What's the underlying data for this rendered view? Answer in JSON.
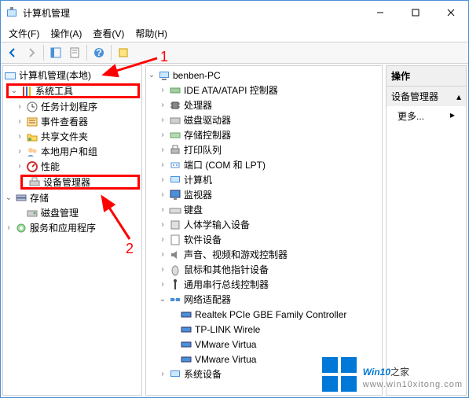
{
  "title": "计算机管理",
  "menus": {
    "file": "文件(F)",
    "action": "操作(A)",
    "view": "查看(V)",
    "help": "帮助(H)"
  },
  "annot": {
    "n1": "1",
    "n2": "2"
  },
  "left": {
    "root": "计算机管理(本地)",
    "systools": "系统工具",
    "tasksched": "任务计划程序",
    "eventvwr": "事件查看器",
    "shared": "共享文件夹",
    "users": "本地用户和组",
    "perf": "性能",
    "devmgr": "设备管理器",
    "storage": "存储",
    "diskmgr": "磁盘管理",
    "services": "服务和应用程序"
  },
  "center": {
    "pc": "benben-PC",
    "ide": "IDE ATA/ATAPI 控制器",
    "cpu": "处理器",
    "diskdrv": "磁盘驱动器",
    "storagectrl": "存储控制器",
    "printq": "打印队列",
    "ports": "端口 (COM 和 LPT)",
    "computer": "计算机",
    "monitor": "监视器",
    "keyboard": "键盘",
    "hid": "人体学输入设备",
    "software": "软件设备",
    "audio": "声音、视频和游戏控制器",
    "mouse": "鼠标和其他指针设备",
    "usb": "通用串行总线控制器",
    "netadapter": "网络适配器",
    "net1": "Realtek PCIe GBE Family Controller",
    "net2": "TP-LINK Wirele",
    "net3": "VMware Virtua",
    "net4": "VMware Virtua",
    "sysdev": "系统设备"
  },
  "right": {
    "header": "操作",
    "section": "设备管理器",
    "more": "更多..."
  },
  "watermark": {
    "brand": "Win10",
    "suffix": "之家",
    "url": "www.win10xitong.com"
  }
}
